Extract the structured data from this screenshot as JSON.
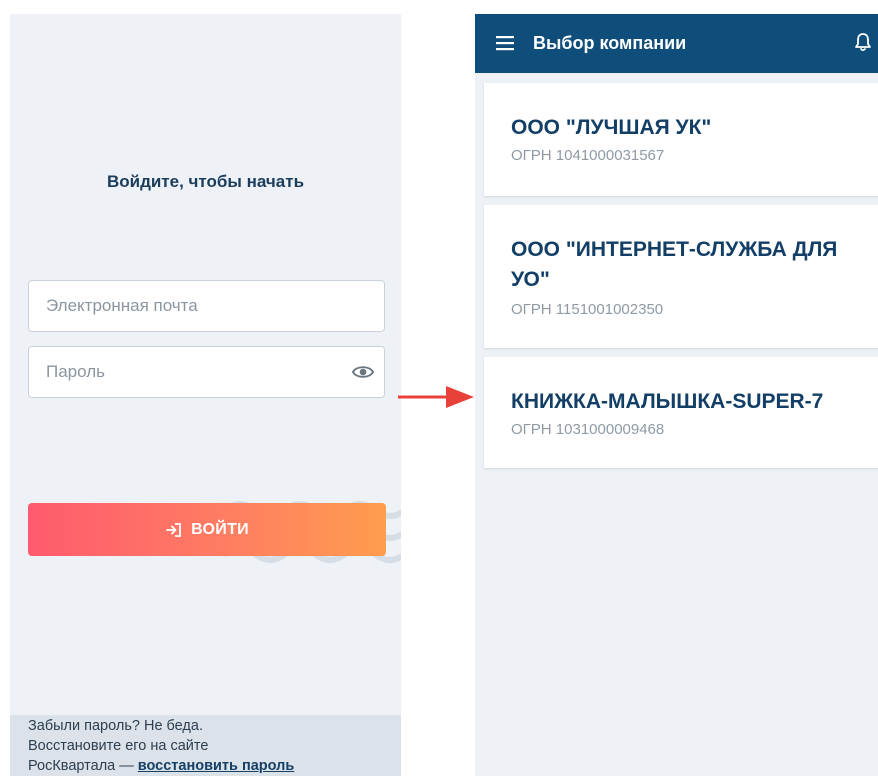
{
  "login": {
    "title": "Войдите, чтобы начать",
    "email_placeholder": "Электронная почта",
    "password_placeholder": "Пароль",
    "submit_label": "ВОЙТИ",
    "forgot_line1": "Забыли пароль? Не беда.",
    "forgot_line2": "Восстановите его на сайте",
    "forgot_line3_prefix": "РосКвартала — ",
    "forgot_link": "восстановить пароль"
  },
  "companies": {
    "title": "Выбор компании",
    "items": [
      {
        "name": "ООО \"ЛУЧШАЯ УК\"",
        "ogrn": "ОГРН 1041000031567"
      },
      {
        "name": "ООО \"ИНТЕРНЕТ-СЛУЖБА ДЛЯ УО\"",
        "ogrn": "ОГРН 1151001002350"
      },
      {
        "name": "КНИЖКА-МАЛЫШКА-SUPER-7",
        "ogrn": "ОГРН 1031000009468"
      }
    ]
  },
  "icons": {
    "password_toggle": "eye-icon",
    "submit": "login-icon",
    "menu": "hamburger-menu-icon",
    "notifications": "bell-icon",
    "transition": "arrow-right-icon"
  },
  "colors": {
    "appbar": "#0f4d7a",
    "title_text": "#1a3d5c",
    "company_name": "#133f66",
    "button_gradient_start": "#ff5a6e",
    "button_gradient_end": "#ff9c4e",
    "arrow": "#e8413a",
    "screen_background": "#eef1f5"
  }
}
